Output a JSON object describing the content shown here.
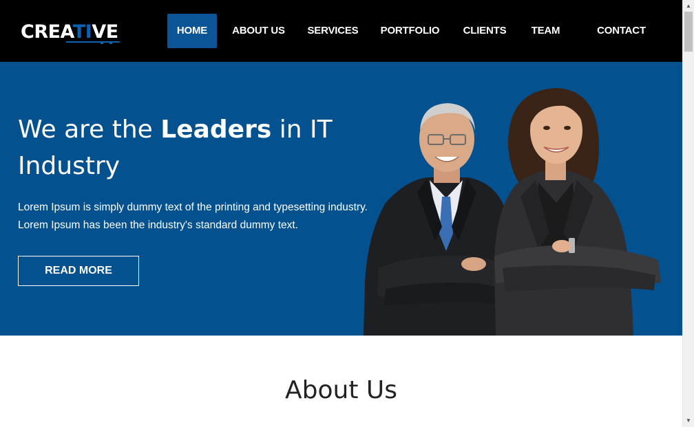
{
  "brand": {
    "logo_prefix": "CREA",
    "logo_accent": "TI",
    "logo_suffix": "VE"
  },
  "nav": {
    "items": [
      {
        "label": "HOME",
        "active": true
      },
      {
        "label": "ABOUT US",
        "active": false
      },
      {
        "label": "SERVICES",
        "active": false
      },
      {
        "label": "PORTFOLIO",
        "active": false
      },
      {
        "label": "CLIENTS",
        "active": false
      },
      {
        "label": "TEAM",
        "active": false
      },
      {
        "label": "CONTACT",
        "active": false
      }
    ]
  },
  "hero": {
    "title_part1": "We are the ",
    "title_bold": "Leaders",
    "title_part2": " in IT Industry",
    "desc_line1": "Lorem Ipsum is simply dummy text of the printing and typesetting industry.",
    "desc_line2": "Lorem Ipsum has been the industry's standard dummy text.",
    "button_label": "READ MORE",
    "image_subject": "two business people with crossed arms"
  },
  "about": {
    "title": "About Us"
  },
  "colors": {
    "navbar_bg": "#000000",
    "hero_bg": "#03528f",
    "accent": "#0b5596",
    "text_light": "#ffffff",
    "heading_dark": "#222222"
  },
  "icons": {
    "scroll_up": "triangle-up-icon",
    "scroll_down": "triangle-down-icon"
  }
}
